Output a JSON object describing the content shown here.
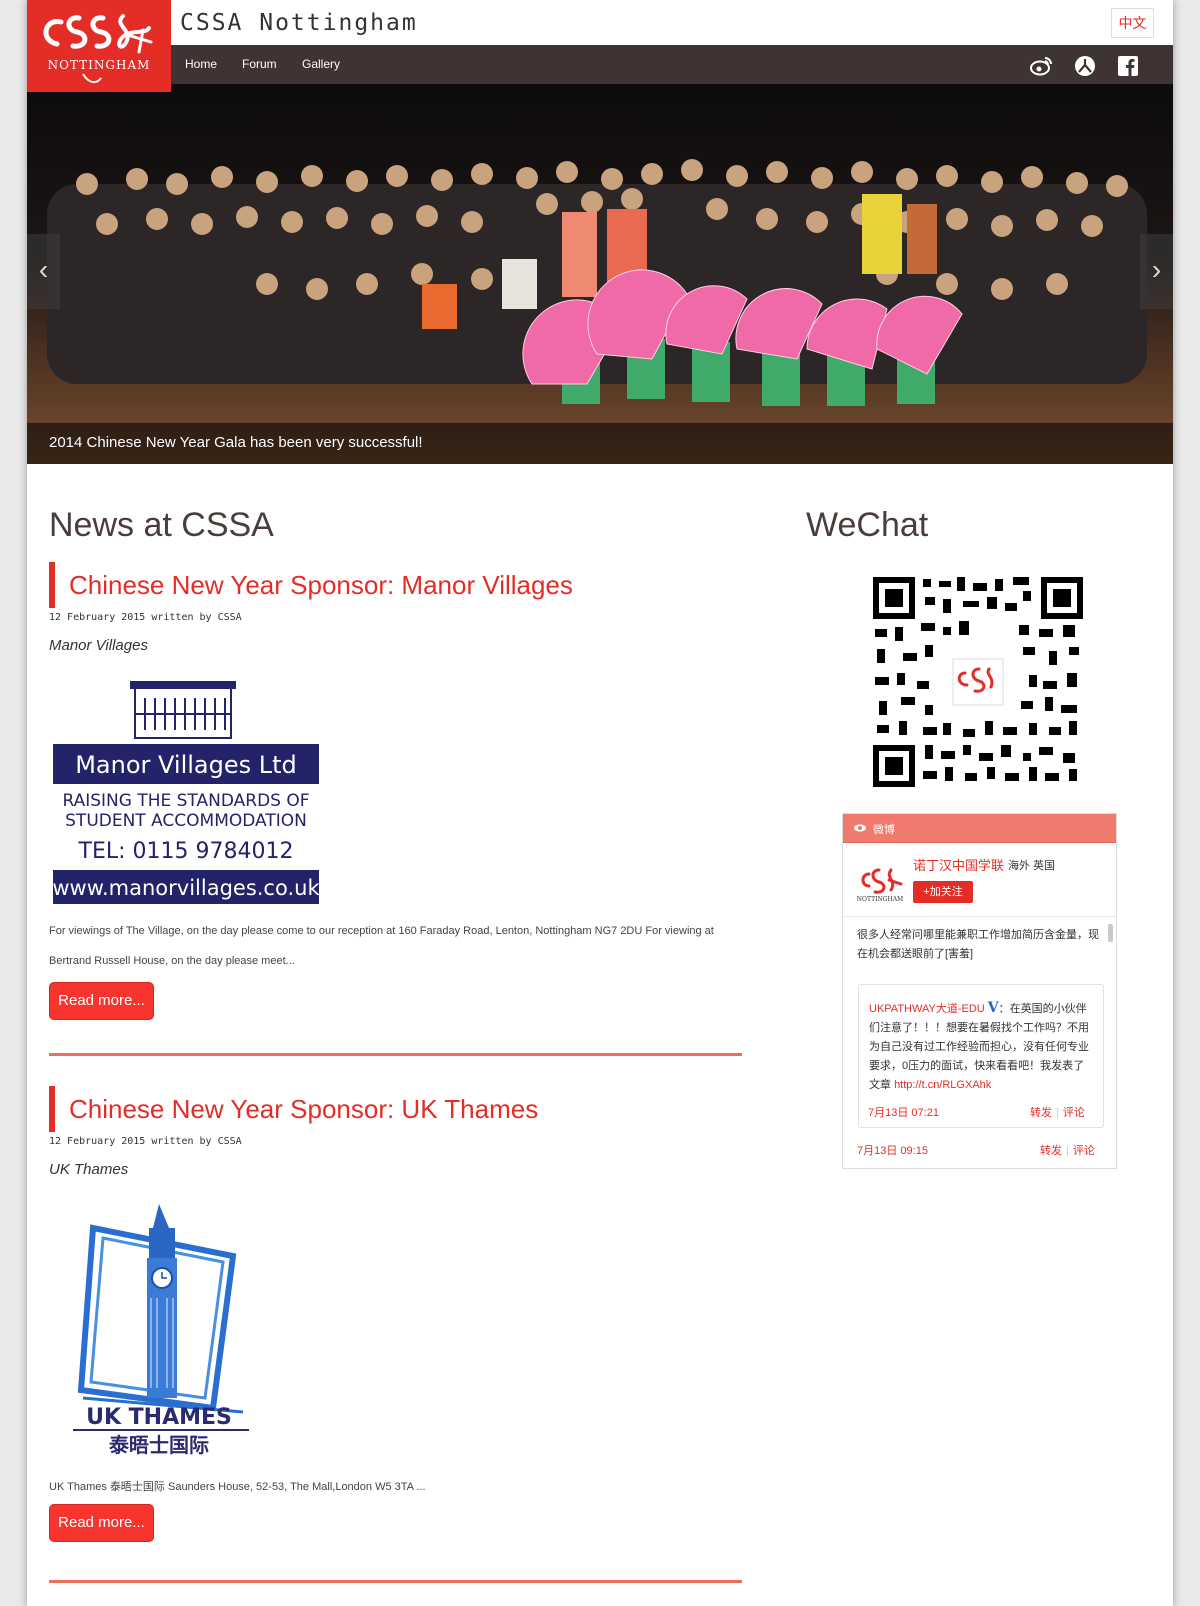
{
  "header": {
    "site_title": "CSSA Nottingham",
    "lang_button": "中文",
    "nav": [
      "Home",
      "Forum",
      "Gallery"
    ],
    "logo_text": "NOTTINGHAM"
  },
  "slider": {
    "caption": "2014 Chinese New Year Gala has been very successful!"
  },
  "main": {
    "news_heading": "News at CSSA",
    "articles": [
      {
        "title": "Chinese New Year Sponsor: Manor Villages",
        "meta": "12 February 2015 written by CSSA",
        "subtitle": "Manor Villages",
        "excerpt": "For viewings of The Village, on the day please come to our reception at 160 Faraday Road, Lenton, Nottingham NG7 2DU For viewing at Bertrand Russell House, on the day please meet...",
        "read_more": "Read more...",
        "logo": {
          "name": "Manor Villages Ltd",
          "line1": "RAISING THE STANDARDS OF",
          "line2": "STUDENT ACCOMMODATION",
          "tel": "TEL:  0115  9784012",
          "url": "www.manorvillages.co.uk"
        }
      },
      {
        "title": "Chinese New Year Sponsor: UK Thames",
        "meta": "12 February 2015 written by CSSA",
        "subtitle": "UK Thames",
        "excerpt": "UK Thames  泰晤士国际 Saunders House, 52-53, The Mall,London W5 3TA ...",
        "read_more": "Read more...",
        "logo": {
          "name": "UK THAMES",
          "cn": "泰晤士国际"
        }
      }
    ]
  },
  "sidebar": {
    "wechat_heading": "WeChat",
    "weibo": {
      "header_label": "微博",
      "account_name": "诺丁汉中国学联",
      "location": "海外 英国",
      "follow_button": "+加关注",
      "post_text": "很多人经常问哪里能兼职工作增加简历含金量，现在机会都送眼前了[害羞]",
      "repost_author": "UKPATHWAY大道-EDU",
      "repost_badge": "V",
      "repost_text": "：在英国的小伙伴们注意了！！！想要在暑假找个工作吗？不用为自己没有过工作经验而担心，没有任何专业要求，0压力的面试，快来看看吧！我发表了文章",
      "repost_link": "http://t.cn/RLGXAhk",
      "repost_time": "7月13日 07:21",
      "post_time": "7月13日 09:15",
      "action_repost": "转发",
      "action_comment": "评论"
    }
  },
  "colors": {
    "brand_red": "#e52d27",
    "nav_bg": "#3f3334",
    "rule": "#ee6e5c",
    "weibo_head": "#f07a6e"
  }
}
